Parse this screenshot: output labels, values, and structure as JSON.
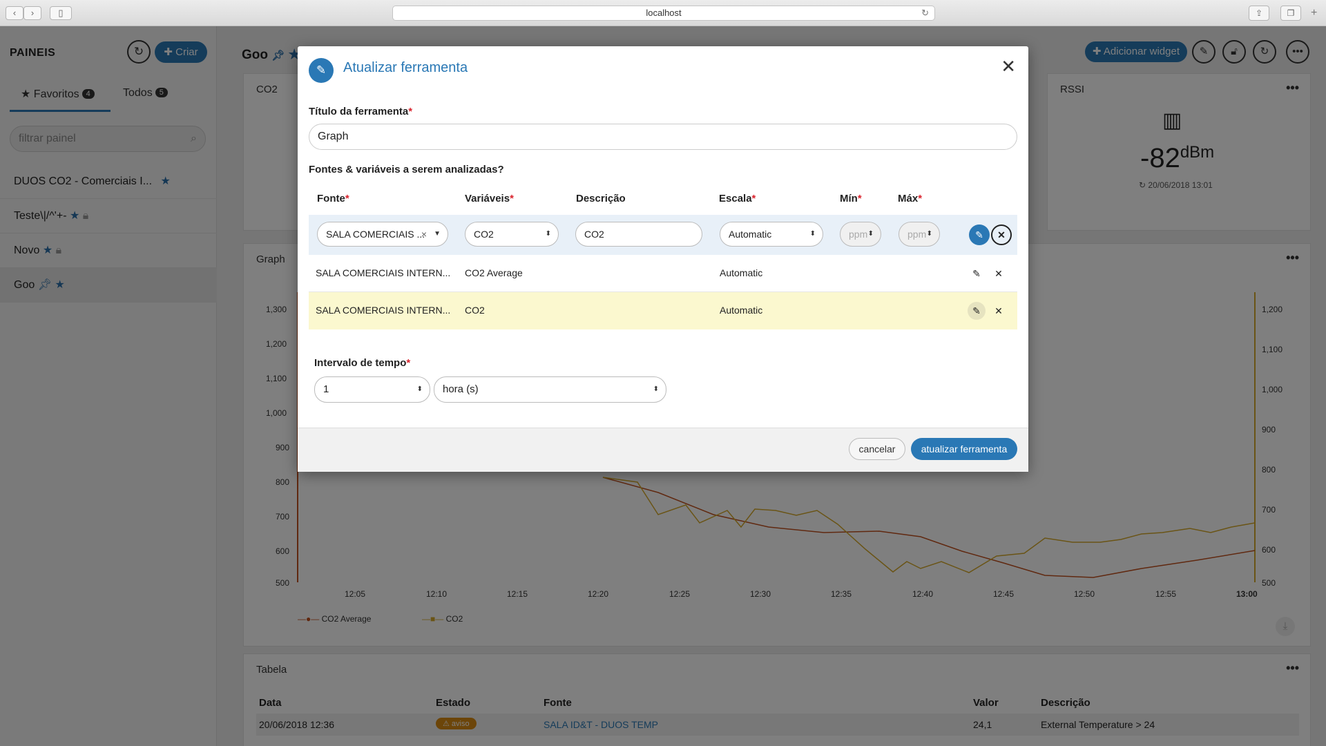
{
  "browser": {
    "url": "localhost"
  },
  "sidebar": {
    "title": "PAINEIS",
    "create_label": "Criar",
    "tabs": [
      {
        "label": "Favoritos",
        "count": "4"
      },
      {
        "label": "Todos",
        "count": "5"
      }
    ],
    "search_placeholder": "filtrar painel",
    "items": [
      {
        "label": "DUOS CO2 - Comerciais I..."
      },
      {
        "label": "Teste\\|/^'+-"
      },
      {
        "label": "Novo"
      },
      {
        "label": "Goo"
      }
    ]
  },
  "main": {
    "title": "Goo",
    "add_widget_label": "Adicionar widget",
    "panels": {
      "co2": "CO2",
      "rssi": "RSSI",
      "rssi_value": "-82",
      "rssi_unit": "dBm",
      "rssi_time": "20/06/2018 13:01",
      "graph": "Graph",
      "table": "Tabela"
    },
    "chart": {
      "left_ticks": [
        "1,300",
        "1,200",
        "1,100",
        "1,000",
        "900",
        "800",
        "700",
        "600",
        "500"
      ],
      "right_ticks": [
        "1,200",
        "1,100",
        "1,000",
        "900",
        "800",
        "700",
        "600",
        "500"
      ],
      "x_ticks": [
        "12:05",
        "12:10",
        "12:15",
        "12:20",
        "12:25",
        "12:30",
        "12:35",
        "12:40",
        "12:45",
        "12:50",
        "12:55",
        "13:00"
      ],
      "legend": [
        "CO2 Average",
        "CO2"
      ]
    },
    "table": {
      "headers": [
        "Data",
        "Estado",
        "Fonte",
        "Valor",
        "Descrição"
      ],
      "row": {
        "date": "20/06/2018 12:36",
        "state": "aviso",
        "source": "SALA ID&T - DUOS TEMP",
        "value": "24,1",
        "desc": "External Temperature > 24"
      }
    }
  },
  "modal": {
    "title": "Atualizar ferramenta",
    "tool_title_label": "Título da ferramenta",
    "tool_title_value": "Graph",
    "sources_label": "Fontes & variáveis a serem analizadas?",
    "columns": {
      "fonte": "Fonte",
      "variaveis": "Variáveis",
      "descricao": "Descrição",
      "escala": "Escala",
      "min": "Mín",
      "max": "Máx"
    },
    "edit_row": {
      "fonte": "SALA COMERCIAIS ...",
      "variavel": "CO2",
      "descricao": "CO2",
      "escala": "Automatic",
      "min_placeholder": "ppm",
      "max_placeholder": "ppm"
    },
    "rows": [
      {
        "fonte": "SALA COMERCIAIS INTERN...",
        "variavel": "CO2 Average",
        "escala": "Automatic"
      },
      {
        "fonte": "SALA COMERCIAIS INTERN...",
        "variavel": "CO2",
        "escala": "Automatic"
      }
    ],
    "interval_label": "Intervalo de tempo",
    "interval_value": "1",
    "interval_unit": "hora (s)",
    "cancel_label": "cancelar",
    "update_label": "atualizar ferramenta"
  },
  "colors": {
    "accent": "#2a78b5",
    "co2_average": "#c0501f",
    "co2": "#d4a82a",
    "required": "#d9232d",
    "highlight_row": "#fbf8cf"
  }
}
